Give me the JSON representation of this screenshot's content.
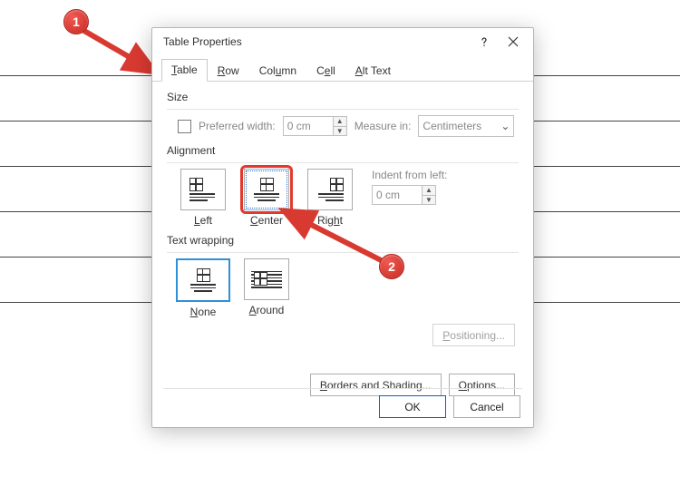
{
  "dialog": {
    "title": "Table Properties"
  },
  "tabs": [
    {
      "u": "T",
      "rest": "able"
    },
    {
      "u": "R",
      "rest": "ow"
    },
    {
      "pre": "Col",
      "u": "u",
      "rest": "mn"
    },
    {
      "pre": "C",
      "u": "e",
      "rest": "ll"
    },
    {
      "u": "A",
      "rest": "lt Text"
    }
  ],
  "size": {
    "title": "Size",
    "pref_pre": "Preferred ",
    "pref_u": "w",
    "pref_rest": "idth:",
    "width_value": "0 cm",
    "measure_u": "M",
    "measure_rest": "easure in:",
    "unit": "Centimeters"
  },
  "alignment": {
    "title": "Alignment",
    "options": [
      {
        "u": "L",
        "rest": "eft"
      },
      {
        "u": "C",
        "rest": "enter"
      },
      {
        "pre": "Rig",
        "u": "h",
        "rest": "t"
      }
    ],
    "selected": "Center",
    "indent_u": "I",
    "indent_rest": "ndent from left:",
    "indent_value": "0 cm"
  },
  "wrap": {
    "title": "Text wrapping",
    "options": [
      {
        "u": "N",
        "rest": "one"
      },
      {
        "u": "A",
        "rest": "round"
      }
    ],
    "selected": "None",
    "positioning_u": "P",
    "positioning_rest": "ositioning..."
  },
  "footer": {
    "borders_u": "B",
    "borders_rest": "orders and Shading...",
    "options_u": "O",
    "options_rest": "ptions...",
    "ok": "OK",
    "cancel": "Cancel"
  },
  "annotations": [
    {
      "num": "1"
    },
    {
      "num": "2"
    }
  ]
}
